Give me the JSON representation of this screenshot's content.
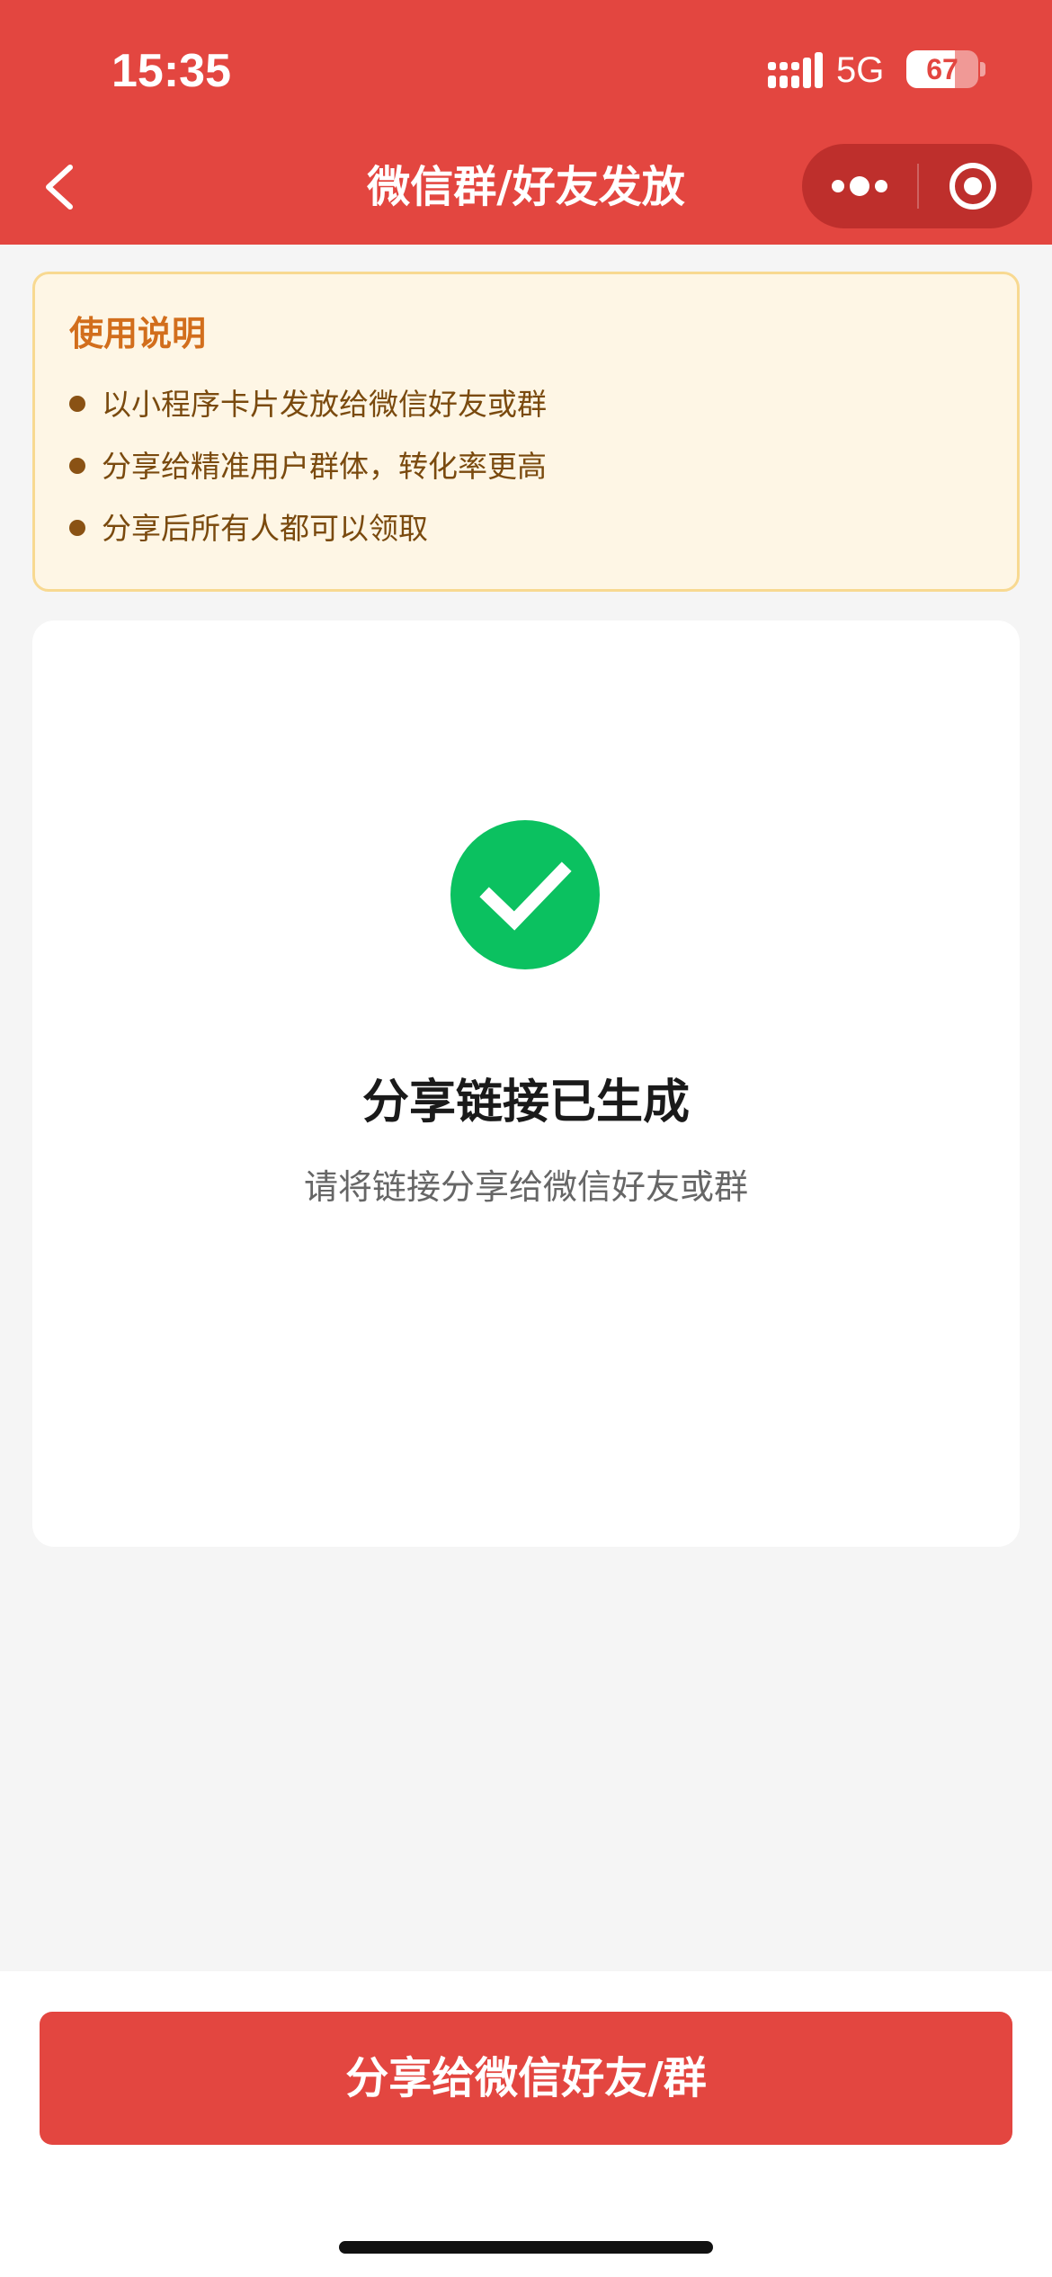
{
  "status_bar": {
    "time": "15:35",
    "network": "5G",
    "battery_level": "67",
    "battery_fraction": 0.67
  },
  "nav": {
    "title": "微信群/好友发放",
    "back_icon": "chevron-left-icon",
    "more_icon": "more-dots-icon",
    "close_icon": "target-close-icon"
  },
  "notice": {
    "title": "使用说明",
    "items": [
      "以小程序卡片发放给微信好友或群",
      "分享给精准用户群体，转化率更高",
      "分享后所有人都可以领取"
    ]
  },
  "result": {
    "icon": "check-circle-icon",
    "title": "分享链接已生成",
    "subtitle": "请将链接分享给微信好友或群"
  },
  "actions": {
    "share_label": "分享给微信好友/群"
  },
  "colors": {
    "primary": "#e34640",
    "success": "#0bc160",
    "notice_bg": "#fef6e5",
    "notice_border": "#f8d991",
    "notice_title": "#d26e1c"
  }
}
